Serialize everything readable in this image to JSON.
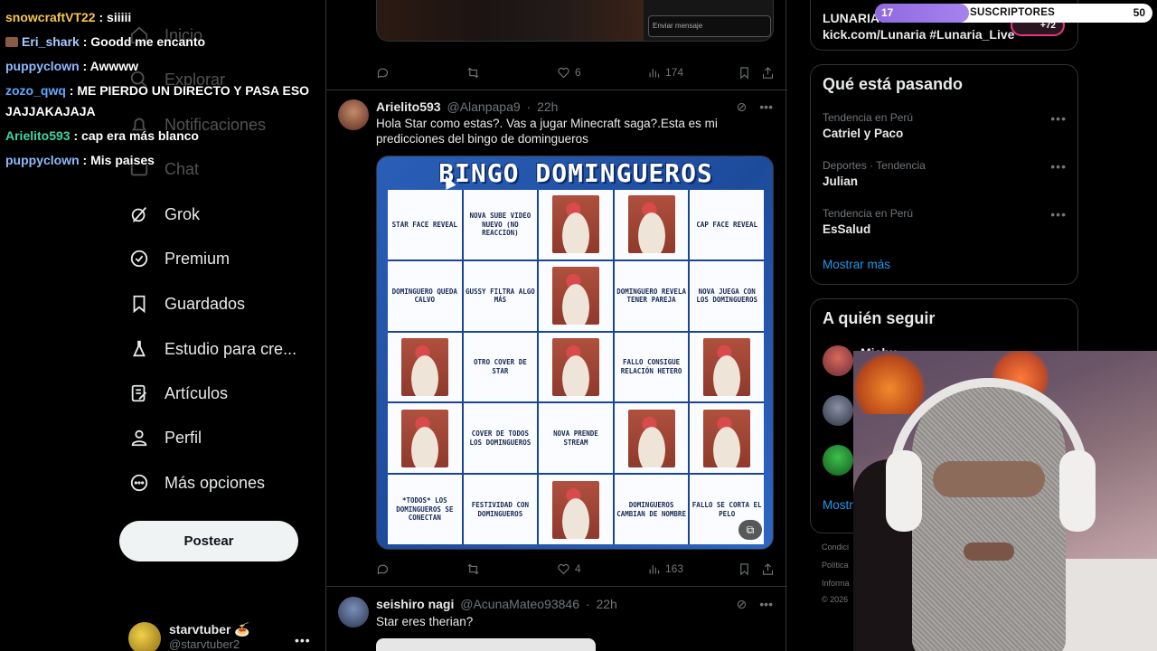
{
  "chat": [
    {
      "user": "snowcraftVT22",
      "color": "#f7c74a",
      "text": " : siiiii",
      "emote": false
    },
    {
      "user": "Eri_shark",
      "color": "#a9c9ff",
      "text": " : Goodd me encanto",
      "emote": true
    },
    {
      "user": "puppyclown",
      "color": "#8fb8ff",
      "text": " : Awwww",
      "emote": false
    },
    {
      "user": "zozo_qwq",
      "color": "#5da8ff",
      "text": " : ME PIERDO UN DIRECTO Y PASA ESO",
      "emote": false
    },
    {
      "user": "",
      "color": "#ffffff",
      "text": "JAJJAKAJAJA",
      "emote": false
    },
    {
      "user": "Arielito593",
      "color": "#3fd6a1",
      "text": " : cap era más blanco",
      "emote": false
    },
    {
      "user": "puppyclown",
      "color": "#8fb8ff",
      "text": " : Mis paises",
      "emote": false
    }
  ],
  "nav": {
    "inicio": "Inicio",
    "explorar": "Explorar",
    "notificaciones": "Notificaciones",
    "chat": "Chat",
    "grok": "Grok",
    "premium": "Premium",
    "guardados": "Guardados",
    "estudio": "Estudio para cre...",
    "articulos": "Artículos",
    "perfil": "Perfil",
    "mas": "Más opciones",
    "postear": "Postear"
  },
  "account": {
    "name": "starvtuber 🍝",
    "handle": "@starvtuber2"
  },
  "prev_tweet": {
    "message_placeholder": "Enviar mensaje",
    "likes": "6",
    "views": "174"
  },
  "tweet": {
    "name": "Arielito593",
    "handle": "@Alanpapa9",
    "time": "22h",
    "text": "Hola Star como estas?. Vas a jugar Minecraft saga?.Esta es mi predicciones del bingo de domingueros",
    "likes": "4",
    "views": "163"
  },
  "bingo": {
    "title": "BINGO DOMINGUEROS",
    "cells": [
      {
        "text": "STAR FACE REVEAL"
      },
      {
        "text": "NOVA SUBE VIDEO NUEVO (no reaccion)"
      },
      {
        "pic": true
      },
      {
        "pic": true
      },
      {
        "text": "CAP FACE REVEAL"
      },
      {
        "text": "DOMINGUERO QUEDA CALVO"
      },
      {
        "text": "GUSSY FILTRA ALGO MÁS"
      },
      {
        "pic": true
      },
      {
        "text": "DOMINGUERO REVELA TENER PAREJA"
      },
      {
        "text": "NOVA JUEGA CON LOS DOMINGUEROS"
      },
      {
        "pic": true
      },
      {
        "text": "OTRO COVER DE STAR"
      },
      {
        "pic": true
      },
      {
        "text": "FALLO CONSIGUE RELACIÓN HETERO"
      },
      {
        "pic": true
      },
      {
        "pic": true
      },
      {
        "text": "COVER DE TODOS LOS DOMINGUEROS"
      },
      {
        "text": "NOVA PRENDE STREAM"
      },
      {
        "pic": true
      },
      {
        "pic": true
      },
      {
        "text": "*TODOS* LOS DOMINGUEROS SE CONECTAN"
      },
      {
        "text": "FESTIVIDAD CON DOMINGUEROS"
      },
      {
        "pic": true
      },
      {
        "text": "DOMINGUEROS CAMBIAN DE NOMBRE"
      },
      {
        "text": "FALLO SE CORTA EL PELO"
      }
    ]
  },
  "next_tweet": {
    "name": "seishiro nagi",
    "handle": "@AcunaMateo93846",
    "time": "22h",
    "text": "Star eres therian?"
  },
  "promo": {
    "line1": "LUNARIA",
    "line2": "kick.com/Lunaria #Lunaria_Live"
  },
  "trends": {
    "title": "Qué está pasando",
    "items": [
      {
        "context": "Tendencia en Perú",
        "topic": "Catriel y Paco"
      },
      {
        "context": "Deportes · Tendencia",
        "topic": "Julian"
      },
      {
        "context": "Tendencia en Perú",
        "topic": "EsSalud"
      }
    ],
    "show_more": "Mostrar más"
  },
  "follow": {
    "title": "A quién seguir",
    "first_name": "Michu",
    "show_more": "Mostr"
  },
  "legal": [
    "Condici",
    "Política",
    "Informa",
    "© 2026"
  ],
  "subgoal": {
    "current": "17",
    "label": "SUSCRIPTORES",
    "goal": "50",
    "progress": 0.34,
    "badge": "+72"
  },
  "colors": {
    "accent": "#1d9bf0",
    "bg": "#000000",
    "border": "#2f3336",
    "subbar": "#8f6adf"
  }
}
